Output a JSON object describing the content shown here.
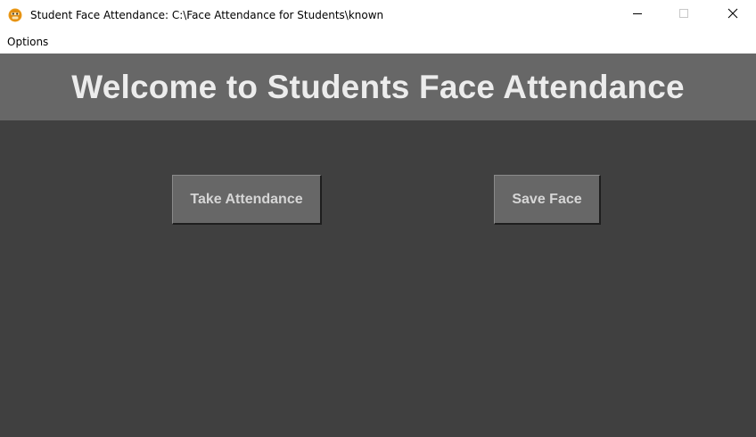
{
  "window": {
    "title": "Student Face Attendance: C:\\Face Attendance for Students\\known",
    "icon": "owl-face-icon",
    "controls": [
      "minimize-icon",
      "maximize-icon",
      "close-icon"
    ]
  },
  "menubar": {
    "items": [
      {
        "label": "Options"
      }
    ]
  },
  "banner": {
    "title": "Welcome to Students Face Attendance"
  },
  "actions": {
    "take_attendance_label": "Take Attendance",
    "save_face_label": "Save Face"
  },
  "colors": {
    "background": "#404040",
    "banner": "#676767",
    "button": "#676767",
    "button_text": "#d6d6d6",
    "banner_text": "#ececec"
  }
}
